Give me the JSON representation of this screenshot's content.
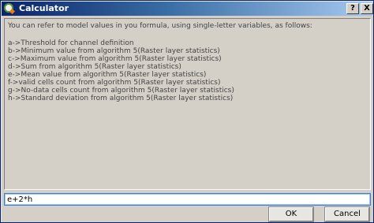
{
  "window": {
    "title": "Calculator",
    "help_button": "?",
    "close_button": "X",
    "icon": "qgis-icon"
  },
  "info": {
    "intro": "You can refer to model values in you formula, using single-letter variables, as follows:",
    "variables": [
      "a->Threshold for channel definition",
      "b->Minimum value from algorithm 5(Raster layer statistics)",
      "c->Maximum value from algorithm 5(Raster layer statistics)",
      "d->Sum from algorithm 5(Raster layer statistics)",
      "e->Mean value from algorithm 5(Raster layer statistics)",
      "f->valid cells count from algorithm 5(Raster layer statistics)",
      "g->No-data cells count from algorithm 5(Raster layer statistics)",
      "h->Standard deviation from algorithm 5(Raster layer statistics)"
    ]
  },
  "formula": {
    "value": "e+2*h"
  },
  "buttons": {
    "ok": "OK",
    "cancel": "Cancel"
  }
}
